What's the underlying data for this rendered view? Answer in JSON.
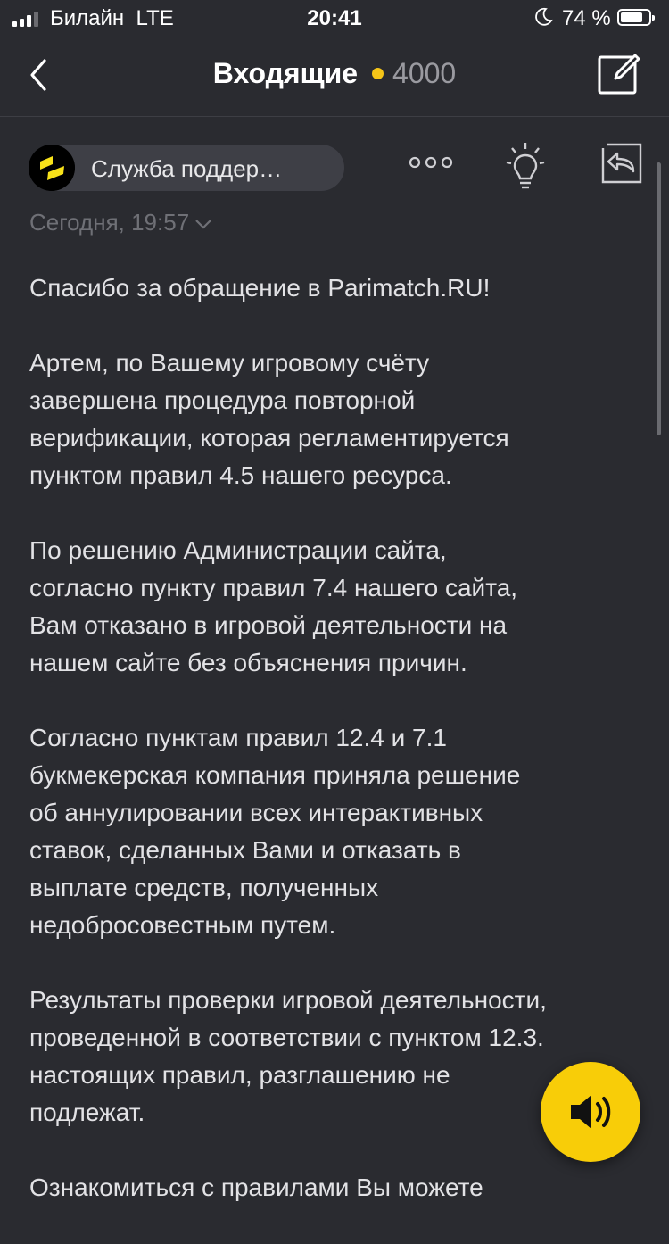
{
  "status_bar": {
    "carrier": "Билайн",
    "network": "LTE",
    "time": "20:41",
    "battery_percent": "74 %",
    "battery_level": 0.74,
    "signal_bars": 3,
    "icons": [
      "signal-icon",
      "moon-icon",
      "battery-icon"
    ]
  },
  "nav": {
    "title": "Входящие",
    "unread_count": "4000",
    "accent_color": "#f5c518",
    "icons": [
      "back-chevron-icon",
      "compose-icon"
    ]
  },
  "message": {
    "sender": "Служба поддер…",
    "date": "Сегодня, 19:57",
    "icons": [
      "parimatch-logo-icon",
      "more-dots-icon",
      "lightbulb-icon",
      "reply-icon",
      "chevron-down-icon"
    ],
    "paragraphs": [
      "Спасибо за обращение в Parimatch.RU!",
      "Артем, по Вашему игровому счёту\nзавершена процедура повторной\nверификации, которая регламентируется\nпунктом правил 4.5 нашего ресурса.",
      "По решению Администрации сайта,\nсогласно пункту правил 7.4 нашего сайта,\nВам отказано в игровой деятельности на\nнашем сайте без объяснения причин.",
      "Согласно пунктам правил 12.4 и 7.1\nбукмекерская компания приняла решение\nоб аннулировании всех интерактивных\nставок, сделанных Вами и отказать в\nвыплате средств, полученных\nнедобросовестным путем.",
      "Результаты проверки игровой деятельности,\nпроведенной в соответствии с пунктом 12.3.\nнастоящих правил, разглашению не\nподлежат.",
      "Ознакомиться с правилами Вы можете"
    ]
  },
  "speaker_button": {
    "icon": "speaker-icon",
    "color": "#f8cd08"
  }
}
